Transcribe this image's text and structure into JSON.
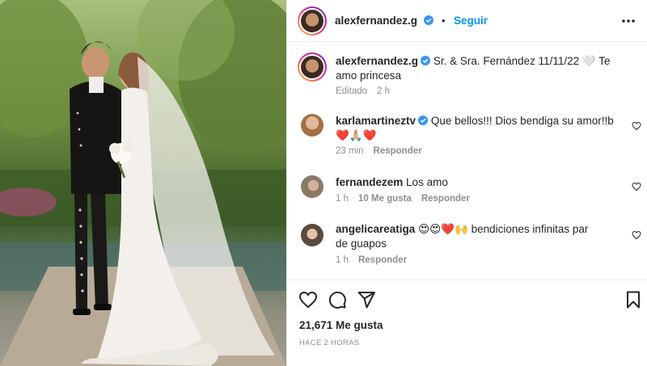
{
  "post": {
    "photo_alt": "Bride and groom in mariachi suit and wedding dress"
  },
  "header": {
    "username": "alexfernandez.g",
    "follow_label": "Seguir",
    "separator": "•"
  },
  "caption": {
    "username": "alexfernandez.g",
    "text": "Sr. & Sra. Fernández 11/11/22 🤍 Te amo princesa",
    "edited_label": "Editado",
    "age": "2 h"
  },
  "comments": [
    {
      "username": "karlamartineztv",
      "verified": true,
      "text": "Que bellos!!! Dios bendiga su amor!!b ❤️🙏🏼❤️",
      "age": "23 min",
      "likes": "",
      "reply_label": "Responder"
    },
    {
      "username": "fernandezem",
      "verified": false,
      "text": "Los amo",
      "age": "1 h",
      "likes": "10 Me gusta",
      "reply_label": "Responder"
    },
    {
      "username": "angelicareatiga",
      "verified": false,
      "text": "😍😍❤️🙌 bendiciones infinitas par de guapos",
      "age": "1 h",
      "likes": "",
      "reply_label": "Responder"
    }
  ],
  "footer": {
    "likes": "21,671 Me gusta",
    "time": "HACE 2 HORAS"
  },
  "colors": {
    "accent": "#0095f6",
    "verified": "#3897f0",
    "muted": "#8e8e8e",
    "heart": "#ed4956"
  },
  "icons": [
    "more-options-icon",
    "verified-badge-icon",
    "heart-icon",
    "comment-icon",
    "share-icon",
    "bookmark-icon"
  ]
}
